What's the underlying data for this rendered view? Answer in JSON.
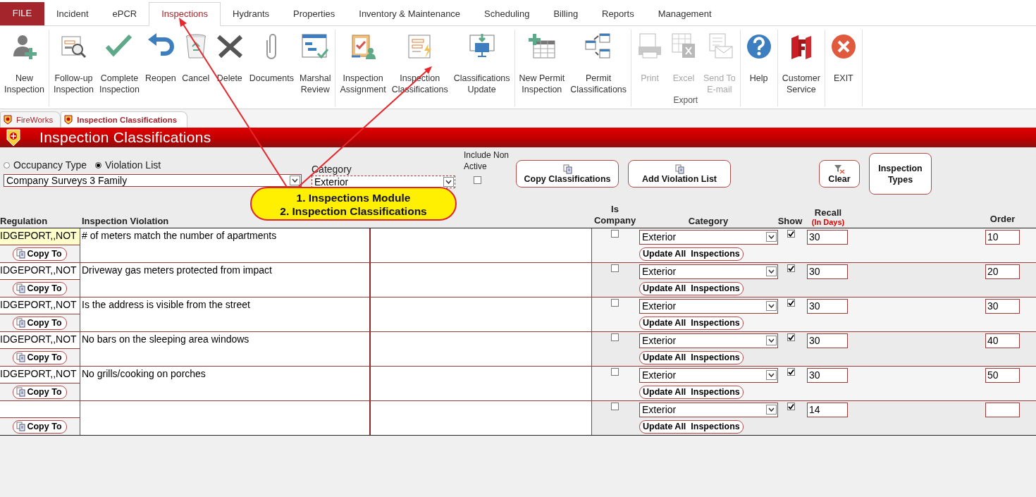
{
  "menu_tabs": [
    {
      "label": "FILE",
      "kind": "file",
      "selected": false
    },
    {
      "label": "Incident",
      "kind": "tab",
      "selected": false
    },
    {
      "label": "ePCR",
      "kind": "tab",
      "selected": false
    },
    {
      "label": "Inspections",
      "kind": "tab",
      "selected": true
    },
    {
      "label": "Hydrants",
      "kind": "tab",
      "selected": false
    },
    {
      "label": "Properties",
      "kind": "tab",
      "selected": false
    },
    {
      "label": "Inventory & Maintenance",
      "kind": "tab",
      "selected": false
    },
    {
      "label": "Scheduling",
      "kind": "tab",
      "selected": false
    },
    {
      "label": "Billing",
      "kind": "tab",
      "selected": false
    },
    {
      "label": "Reports",
      "kind": "tab",
      "selected": false
    },
    {
      "label": "Management",
      "kind": "tab",
      "selected": false
    }
  ],
  "ribbon": {
    "groups": [
      {
        "buttons": [
          {
            "lines": [
              "New",
              "Inspection"
            ],
            "disabled": false
          }
        ]
      },
      {
        "buttons": [
          {
            "lines": [
              "Follow-up",
              "Inspection"
            ],
            "disabled": false
          },
          {
            "lines": [
              "Complete",
              "Inspection"
            ],
            "disabled": false
          },
          {
            "lines": [
              "Reopen"
            ],
            "disabled": false
          },
          {
            "lines": [
              "Cancel"
            ],
            "disabled": false
          },
          {
            "lines": [
              "Delete"
            ],
            "disabled": false
          },
          {
            "lines": [
              "Documents"
            ],
            "disabled": false
          },
          {
            "lines": [
              "Marshal",
              "Review"
            ],
            "disabled": false
          }
        ]
      },
      {
        "buttons": [
          {
            "lines": [
              "Inspection",
              "Assignment"
            ],
            "disabled": false
          },
          {
            "lines": [
              "Inspection",
              "Classifications"
            ],
            "disabled": false
          },
          {
            "lines": [
              "Classifications",
              "Update"
            ],
            "disabled": false
          }
        ]
      },
      {
        "buttons": [
          {
            "lines": [
              "New Permit",
              "Inspection"
            ],
            "disabled": false
          },
          {
            "lines": [
              "Permit",
              "Classifications"
            ],
            "disabled": false
          }
        ]
      },
      {
        "label": "Export",
        "buttons": [
          {
            "lines": [
              "Print"
            ],
            "disabled": true
          },
          {
            "lines": [
              "Excel"
            ],
            "disabled": true
          },
          {
            "lines": [
              "Send To",
              "E-mail"
            ],
            "disabled": true
          }
        ]
      },
      {
        "buttons": [
          {
            "lines": [
              "Help"
            ],
            "disabled": false
          }
        ]
      },
      {
        "buttons": [
          {
            "lines": [
              "Customer",
              "Service"
            ],
            "disabled": false
          }
        ]
      },
      {
        "buttons": [
          {
            "lines": [
              "EXIT"
            ],
            "disabled": false
          }
        ]
      }
    ]
  },
  "document_tabs": [
    {
      "label": "FireWorks",
      "selected": false
    },
    {
      "label": "Inspection Classifications",
      "selected": true
    }
  ],
  "form": {
    "title": "Inspection Classifications",
    "list_type": [
      {
        "label": "Occupancy Type",
        "selected": false
      },
      {
        "label": "Violation List",
        "selected": true
      }
    ],
    "list_value": "Company Surveys 3 Family",
    "category": {
      "label": "Category",
      "value": "Exterior"
    },
    "include_non_active": {
      "label": "Include Non Active",
      "checked": false
    },
    "buttons": [
      {
        "label": "Copy Classifications",
        "kind": "icon"
      },
      {
        "label": "Add Violation List",
        "kind": "icon"
      },
      {
        "label": "Clear",
        "kind": "filter"
      },
      {
        "label": "Inspection Types",
        "kind": "tall"
      }
    ]
  },
  "table": {
    "columns": {
      "regulation": "Regulation",
      "violation": "Inspection Violation",
      "is_company": "Is Company",
      "category": "Category",
      "show": "Show",
      "recall": "Recall",
      "recall_unit": "(In Days)",
      "order": "Order"
    },
    "rows": [
      {
        "regulation": "IDGEPORT,,NOT",
        "selected": true,
        "copy_button": "Copy To",
        "violation": "# of meters match the number of apartments",
        "is_company": false,
        "category": "Exterior",
        "show": true,
        "recall": "30",
        "order": "10",
        "update_button": "Update All  Inspections"
      },
      {
        "regulation": "IDGEPORT,,NOT",
        "selected": false,
        "copy_button": "Copy To",
        "violation": "Driveway gas meters protected from impact",
        "is_company": false,
        "category": "Exterior",
        "show": true,
        "recall": "30",
        "order": "20",
        "update_button": "Update All  Inspections"
      },
      {
        "regulation": "IDGEPORT,,NOT",
        "selected": false,
        "copy_button": "Copy To",
        "violation": "Is the address is visible from the street",
        "is_company": false,
        "category": "Exterior",
        "show": true,
        "recall": "30",
        "order": "30",
        "update_button": "Update All  Inspections"
      },
      {
        "regulation": "IDGEPORT,,NOT",
        "selected": false,
        "copy_button": "Copy To",
        "violation": "No bars on the sleeping area windows",
        "is_company": false,
        "category": "Exterior",
        "show": true,
        "recall": "30",
        "order": "40",
        "update_button": "Update All  Inspections"
      },
      {
        "regulation": "IDGEPORT,,NOT",
        "selected": false,
        "copy_button": "Copy To",
        "violation": "No grills/cooking on porches",
        "is_company": false,
        "category": "Exterior",
        "show": true,
        "recall": "30",
        "order": "50",
        "update_button": "Update All  Inspections"
      },
      {
        "selected": false,
        "copy_button": "Copy To",
        "is_company": false,
        "category": "Exterior",
        "show": true,
        "recall": "14",
        "update_button": "Update All  Inspections"
      }
    ]
  },
  "annotation": {
    "lines": [
      "1. Inspections Module",
      "2. Inspection Classifications"
    ]
  }
}
